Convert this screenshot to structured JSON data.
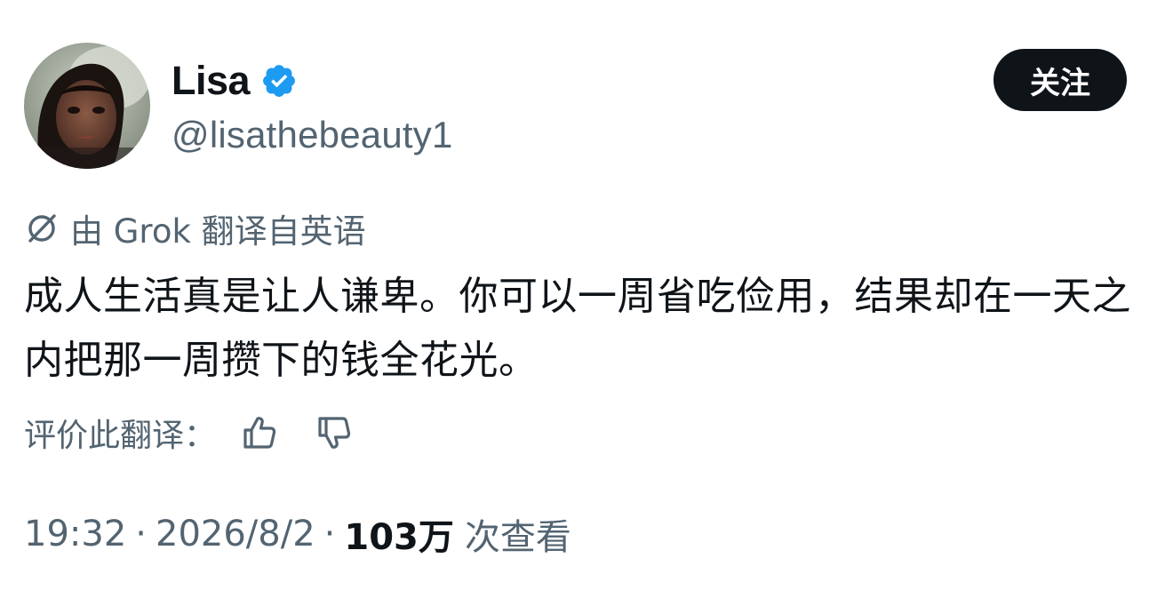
{
  "author": {
    "display_name": "Lisa",
    "handle": "@lisathebeauty1",
    "avatar_icon": "profile-photo",
    "verified_icon": "verified-badge-icon",
    "verified_color": "#1d9bf0"
  },
  "follow_button": {
    "label": "关注"
  },
  "translation": {
    "icon": "grok-icon",
    "note": "由 Grok 翻译自英语"
  },
  "tweet": {
    "text": "成人生活真是让人谦卑。你可以一周省吃俭用，结果却在一天之内把那一周攒下的钱全花光。"
  },
  "rating": {
    "label": "评价此翻译：",
    "thumbs_up_icon": "thumbs-up-icon",
    "thumbs_down_icon": "thumbs-down-icon"
  },
  "meta": {
    "time": "19:32",
    "separator": "·",
    "date": "2026/8/2",
    "views_count": "103万",
    "views_label": "次查看"
  },
  "colors": {
    "text_primary": "#0f1419",
    "text_secondary": "#536471",
    "button_bg": "#0f1419",
    "accent": "#1d9bf0"
  }
}
